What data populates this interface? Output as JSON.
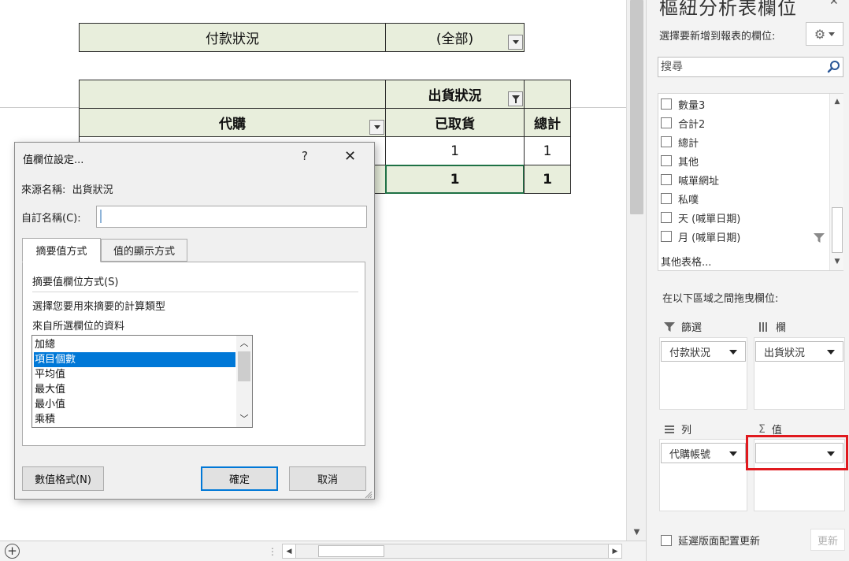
{
  "sheet": {
    "page_filter_label": "付款狀況",
    "page_filter_value": "(全部)",
    "column_header_title": "出貨狀況",
    "row_header_title": "代購",
    "column_value_header": "已取貨",
    "grand_total_header": "總計",
    "data_value": "1",
    "data_total": "1",
    "grand_value": "1",
    "grand_total": "1"
  },
  "dialog": {
    "title": "值欄位設定...",
    "help": "?",
    "close": "✕",
    "source_label": "來源名稱:",
    "source_value": "出貨狀況",
    "custom_name_label": "自訂名稱(C):",
    "custom_name_value": "",
    "tabs": [
      {
        "label": "摘要值方式",
        "active": true
      },
      {
        "label": "值的顯示方式",
        "active": false
      }
    ],
    "summarize_heading": "摘要值欄位方式(S)",
    "description_line1": "選擇您要用來摘要的計算類型",
    "description_line2": "來自所選欄位的資料",
    "calc_options": [
      "加總",
      "項目個數",
      "平均值",
      "最大值",
      "最小值",
      "乘積"
    ],
    "selected_option": "項目個數",
    "number_format_button": "數值格式(N)",
    "ok_button": "確定",
    "cancel_button": "取消"
  },
  "pane": {
    "title": "樞紐分析表欄位",
    "close": "✕",
    "choose_fields_label": "選擇要新增到報表的欄位:",
    "search_placeholder": "搜尋",
    "fields": [
      "數量3",
      "合計2",
      "總計",
      "其他",
      "喊單網址",
      "私噗",
      "天 (喊單日期)",
      "月 (喊單日期)"
    ],
    "more_tables": "其他表格...",
    "drag_hint": "在以下區域之間拖曳欄位:",
    "areas": {
      "filters": {
        "label": "篩選",
        "items": [
          "付款狀況"
        ]
      },
      "columns": {
        "label": "欄",
        "items": [
          "出貨狀況"
        ]
      },
      "rows": {
        "label": "列",
        "items": [
          "代購帳號"
        ]
      },
      "values": {
        "label": "值",
        "items": [
          ""
        ]
      }
    },
    "defer_label": "延遲版面配置更新",
    "update_button": "更新"
  },
  "colors": {
    "pivot_header_bg": "#e8eedc",
    "selected_cell_border": "#1e7145",
    "list_selection": "#0078d7",
    "highlight_box": "#e0191e"
  }
}
